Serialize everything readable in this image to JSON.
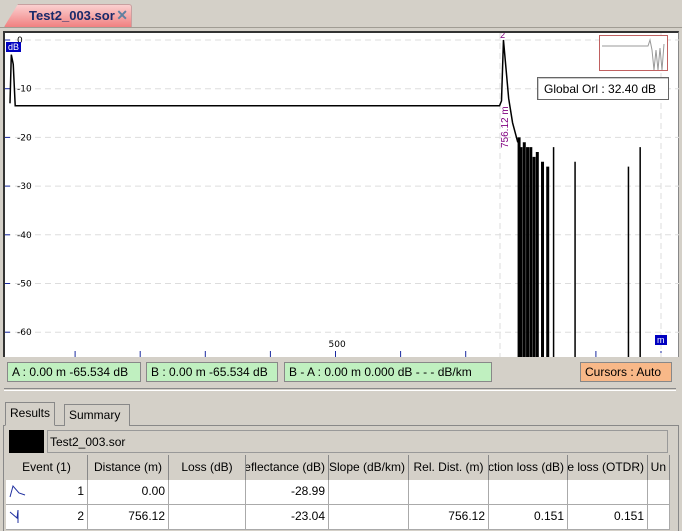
{
  "tab": {
    "title": "Test2_003.sor",
    "close_icon": "close-x-icon"
  },
  "chart": {
    "y_unit": "dB",
    "x_unit": "m",
    "y_ticks": [
      "0",
      "-10",
      "-20",
      "-30",
      "-40",
      "-50",
      "-60"
    ],
    "x_ticks": [
      "500"
    ],
    "event_markers": [
      {
        "label": "2",
        "distance_label": "756.12 m"
      }
    ],
    "global_orl": "Global Orl : 32.40 dB",
    "trace": {
      "x": [
        0,
        2,
        5,
        8,
        752,
        755,
        758,
        760,
        766,
        772,
        780
      ],
      "y": [
        -13,
        -3,
        -5,
        -13.5,
        -13.5,
        -12.5,
        0,
        -3,
        -12,
        -17,
        -21
      ]
    },
    "noise_spikes": [
      [
        782,
        -20
      ],
      [
        785,
        -22
      ],
      [
        790,
        -21
      ],
      [
        795,
        -22
      ],
      [
        800,
        -22
      ],
      [
        805,
        -24
      ],
      [
        810,
        -23
      ],
      [
        818,
        -25
      ],
      [
        826,
        -26
      ],
      [
        835,
        -22
      ],
      [
        868,
        -25
      ],
      [
        950,
        -26
      ],
      [
        968,
        -22
      ]
    ],
    "colors": {
      "trace": "#000000",
      "axis_labels": "#1a2aa0",
      "marker": "#800080"
    }
  },
  "cursors": {
    "a": "A : 0.00 m  -65.534 dB",
    "b": "B : 0.00 m  -65.534 dB",
    "ba": "B - A : 0.00 m   0.000 dB - - - dB/km",
    "mode": "Cursors : Auto"
  },
  "results": {
    "tabs": [
      "Results",
      "Summary"
    ],
    "file": "Test2_003.sor",
    "columns": [
      "Event (1)",
      "Distance (m)",
      "Loss (dB)",
      "Reflectance (dB)",
      "Slope (dB/km)",
      "Rel. Dist. (m)",
      "Injection loss (dB)",
      "Splice loss (OTDR)",
      "Un"
    ],
    "rows": [
      {
        "icon": "reflective-event-icon",
        "cells": [
          "1",
          "0.00",
          "",
          "-28.99",
          "",
          "",
          "",
          "",
          ""
        ]
      },
      {
        "icon": "end-event-icon",
        "cells": [
          "2",
          "756.12",
          "",
          "-23.04",
          "",
          "756.12",
          "0.151",
          "0.151",
          ""
        ]
      }
    ]
  }
}
